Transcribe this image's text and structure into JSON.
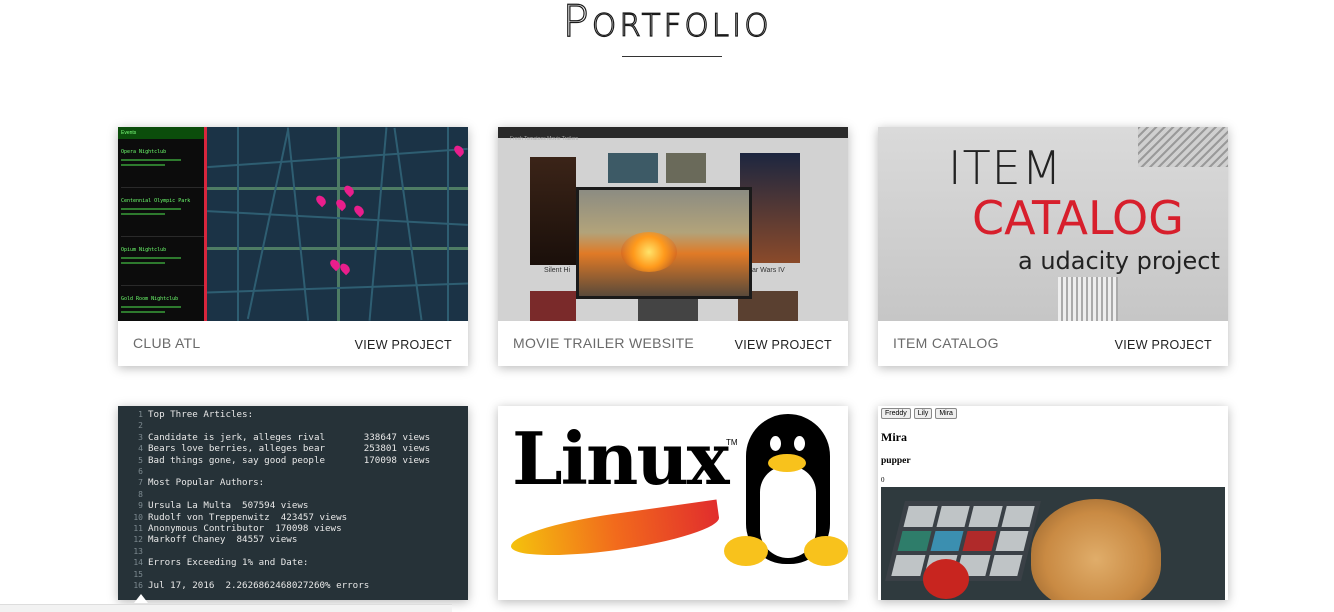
{
  "page": {
    "title": "Portfolio"
  },
  "projects": [
    {
      "name": "CLUB ATL",
      "link_label": "VIEW PROJECT"
    },
    {
      "name": "MOVIE TRAILER WEBSITE",
      "link_label": "VIEW PROJECT"
    },
    {
      "name": "ITEM CATALOG",
      "link_label": "VIEW PROJECT"
    }
  ],
  "club_atl_thumb": {
    "header": "Events",
    "entries": [
      "Opera Nightclub",
      "Centennial Olympic Park",
      "Opium Nightclub",
      "Gold Room Nightclub"
    ]
  },
  "movie_thumb": {
    "header": "Fresh Tomatoes Movie Trailers",
    "captions": [
      "Silent Hi",
      "ar Wars IV"
    ]
  },
  "item_catalog_thumb": {
    "line1": "ITEM",
    "line2": "CATALOG",
    "line3": "a udacity project"
  },
  "terminal_thumb": {
    "lines": [
      {
        "n": "1",
        "text": "Top Three Articles:"
      },
      {
        "n": "2",
        "text": ""
      },
      {
        "n": "3",
        "text": "Candidate is jerk, alleges rival       338647 views"
      },
      {
        "n": "4",
        "text": "Bears love berries, alleges bear       253801 views"
      },
      {
        "n": "5",
        "text": "Bad things gone, say good people       170098 views"
      },
      {
        "n": "6",
        "text": ""
      },
      {
        "n": "7",
        "text": "Most Popular Authors:"
      },
      {
        "n": "8",
        "text": ""
      },
      {
        "n": "9",
        "text": "Ursula La Multa  507594 views"
      },
      {
        "n": "10",
        "text": "Rudolf von Treppenwitz  423457 views"
      },
      {
        "n": "11",
        "text": "Anonymous Contributor  170098 views"
      },
      {
        "n": "12",
        "text": "Markoff Chaney  84557 views"
      },
      {
        "n": "13",
        "text": ""
      },
      {
        "n": "14",
        "text": "Errors Exceeding 1% and Date:"
      },
      {
        "n": "15",
        "text": ""
      },
      {
        "n": "16",
        "text": "Jul 17, 2016  2.2626862468027260% errors"
      }
    ]
  },
  "linux_thumb": {
    "word": "Linux",
    "tm": "TM"
  },
  "dog_thumb": {
    "buttons": [
      "Freddy",
      "Lily",
      "Mira"
    ],
    "name": "Mira",
    "subtitle": "pupper",
    "count": "0"
  },
  "colors": {
    "accent_red": "#d71f2c",
    "terminal_bg": "#263238",
    "club_green": "#6dff6d",
    "pin_pink": "#e91e8c"
  }
}
